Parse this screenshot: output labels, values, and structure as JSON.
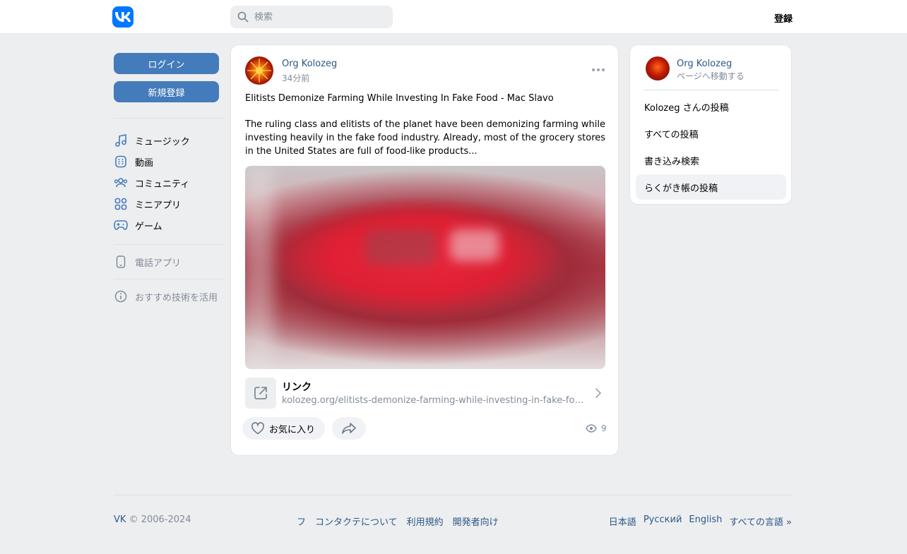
{
  "header": {
    "search_placeholder": "検索",
    "register_label": "登録"
  },
  "sidebar": {
    "login_label": "ログイン",
    "signup_label": "新規登録",
    "items": [
      {
        "label": "ミュージック",
        "icon": "music-icon"
      },
      {
        "label": "動画",
        "icon": "video-icon"
      },
      {
        "label": "コミュニティ",
        "icon": "community-icon"
      },
      {
        "label": "ミニアプリ",
        "icon": "mini-apps-icon"
      },
      {
        "label": "ゲーム",
        "icon": "gamepad-icon"
      }
    ],
    "phone_app_label": "電話アプリ",
    "recommend_label": "おすすめ技術を活用"
  },
  "post": {
    "author": "Org Kolozeg",
    "time": "34分前",
    "title": "Elitists Demonize Farming While Investing In Fake Food - Mac Slavo",
    "body": "The ruling class and elitists of the planet have been demonizing farming while investing heavily in the fake food industry. Already, most of the grocery stores in the United States are full of food-like products...",
    "link_title": "リンク",
    "link_url": "kolozeg.org/elitists-demonize-farming-while-investing-in-fake-food-...",
    "like_label": "お気に入り",
    "views": "9"
  },
  "right_panel": {
    "name": "Org Kolozeg",
    "sub": "ページへ移動する",
    "items": [
      {
        "label": "Kolozeg さんの投稿"
      },
      {
        "label": "すべての投稿"
      },
      {
        "label": "書き込み検索"
      },
      {
        "label": "らくがき帳の投稿"
      }
    ]
  },
  "footer": {
    "vk": "VK",
    "copyright": "© 2006-2024",
    "links": [
      "フ",
      "コンタクテについて",
      "利用規約",
      "開発者向け"
    ],
    "languages": [
      "日本語",
      "Русский",
      "English",
      "すべての言語 »"
    ]
  },
  "colors": {
    "brand": "#0077ff",
    "button": "#447bba",
    "link": "#2a5885",
    "muted": "#818c99"
  }
}
